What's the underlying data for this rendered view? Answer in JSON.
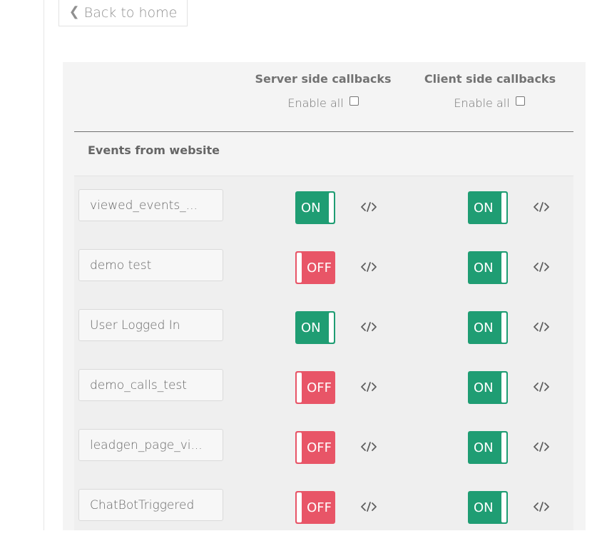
{
  "page": {
    "back_label": "Back to home",
    "back_icon": "chevron-left-icon"
  },
  "table": {
    "server_header": "Server side callbacks",
    "client_header": "Client side callbacks",
    "enable_all_label": "Enable all",
    "section_title": "Events from website"
  },
  "colors": {
    "on": "#1f9d73",
    "off": "#e85567"
  },
  "events": [
    {
      "name": "viewed_events_...",
      "server": "ON",
      "client": "ON"
    },
    {
      "name": "demo test",
      "server": "OFF",
      "client": "ON"
    },
    {
      "name": "User Logged In",
      "server": "ON",
      "client": "ON"
    },
    {
      "name": "demo_calls_test",
      "server": "OFF",
      "client": "ON"
    },
    {
      "name": "leadgen_page_vi...",
      "server": "OFF",
      "client": "ON"
    },
    {
      "name": "ChatBotTriggered",
      "server": "OFF",
      "client": "ON"
    }
  ]
}
